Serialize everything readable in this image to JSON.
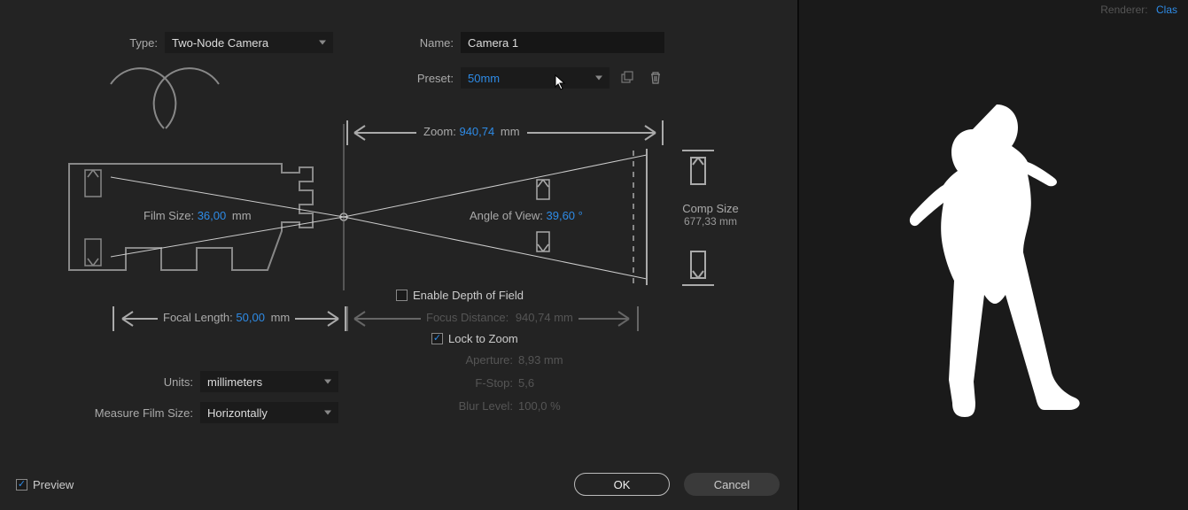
{
  "header": {
    "type_label": "Type:",
    "type_value": "Two-Node Camera",
    "name_label": "Name:",
    "name_value": "Camera 1",
    "preset_label": "Preset:",
    "preset_value": "50mm"
  },
  "diagram": {
    "zoom_label": "Zoom:",
    "zoom_value": "940,74",
    "zoom_unit": "mm",
    "film_size_label": "Film Size:",
    "film_size_value": "36,00",
    "film_size_unit": "mm",
    "angle_label": "Angle of View:",
    "angle_value": "39,60",
    "angle_unit": "°",
    "comp_size_label": "Comp Size",
    "comp_size_value": "677,33 mm",
    "focal_length_label": "Focal Length:",
    "focal_length_value": "50,00",
    "focal_length_unit": "mm"
  },
  "options": {
    "enable_dof_label": "Enable Depth of Field",
    "focus_distance_label": "Focus Distance:",
    "focus_distance_value": "940,74 mm",
    "lock_zoom_label": "Lock to Zoom",
    "aperture_label": "Aperture:",
    "aperture_value": "8,93 mm",
    "fstop_label": "F-Stop:",
    "fstop_value": "5,6",
    "blur_label": "Blur Level:",
    "blur_value": "100,0 %",
    "units_label": "Units:",
    "units_value": "millimeters",
    "measure_label": "Measure Film Size:",
    "measure_value": "Horizontally"
  },
  "footer": {
    "preview_label": "Preview",
    "ok_label": "OK",
    "cancel_label": "Cancel"
  },
  "right": {
    "renderer_label": "Renderer:",
    "renderer_value": "Clas"
  }
}
